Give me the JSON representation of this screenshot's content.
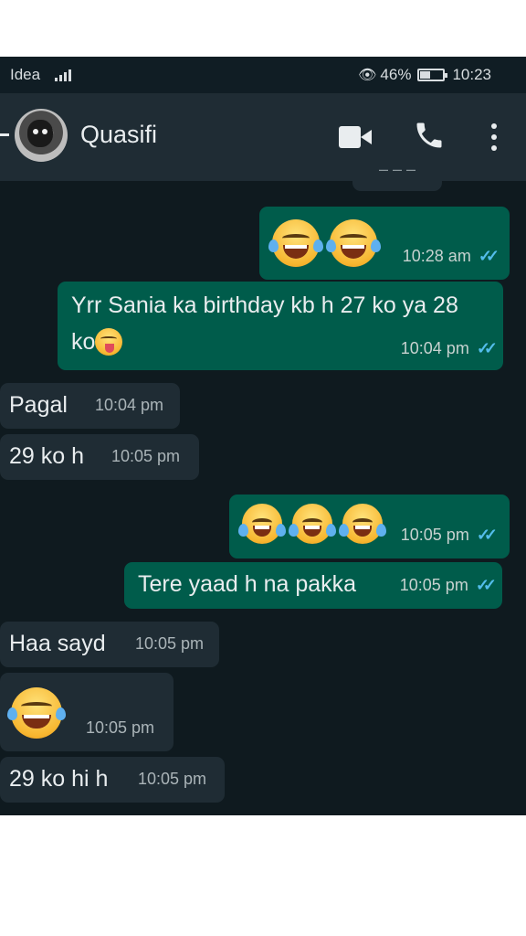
{
  "status_bar": {
    "carrier": "Idea",
    "battery_level": 0.46,
    "battery_text": "46%",
    "time": "10:23",
    "icons": [
      "signal-icon",
      "eye-icon",
      "battery-icon"
    ]
  },
  "header": {
    "contact_name": "Quasifi",
    "icons": [
      "back-arrow-icon",
      "avatar",
      "video-call-icon",
      "voice-call-icon",
      "more-options-icon"
    ]
  },
  "colors": {
    "chat_background": "#0f1a1f",
    "header": "#1f2c34",
    "outgoing_bubble": "#005c4b",
    "incoming_bubble": "#1f2c34",
    "read_ticks": "#53bdeb"
  },
  "messages": [
    {
      "direction": "out",
      "type": "emoji",
      "emoji": "face-with-tears-of-joy",
      "count": 2,
      "time": "10:28 am",
      "status": "read"
    },
    {
      "direction": "out",
      "type": "text",
      "text_line1": "Yrr Sania ka birthday kb h 27 ko ya 28",
      "text_line2": "ko",
      "trailing_emoji": "winking-face-with-tongue",
      "time": "10:04 pm",
      "status": "read"
    },
    {
      "direction": "in",
      "type": "text",
      "text": "Pagal",
      "time": "10:04 pm"
    },
    {
      "direction": "in",
      "type": "text",
      "text": "29 ko h",
      "time": "10:05 pm"
    },
    {
      "direction": "out",
      "type": "emoji",
      "emoji": "face-with-tears-of-joy",
      "count": 3,
      "time": "10:05 pm",
      "status": "read"
    },
    {
      "direction": "out",
      "type": "text",
      "text": "Tere yaad h na pakka",
      "time": "10:05 pm",
      "status": "read"
    },
    {
      "direction": "in",
      "type": "text",
      "text": "Haa sayd",
      "time": "10:05 pm"
    },
    {
      "direction": "in",
      "type": "emoji",
      "emoji": "face-with-tears-of-joy",
      "count": 1,
      "time": "10:05 pm"
    },
    {
      "direction": "in",
      "type": "text",
      "text": "29 ko hi h",
      "time": "10:05 pm"
    }
  ]
}
